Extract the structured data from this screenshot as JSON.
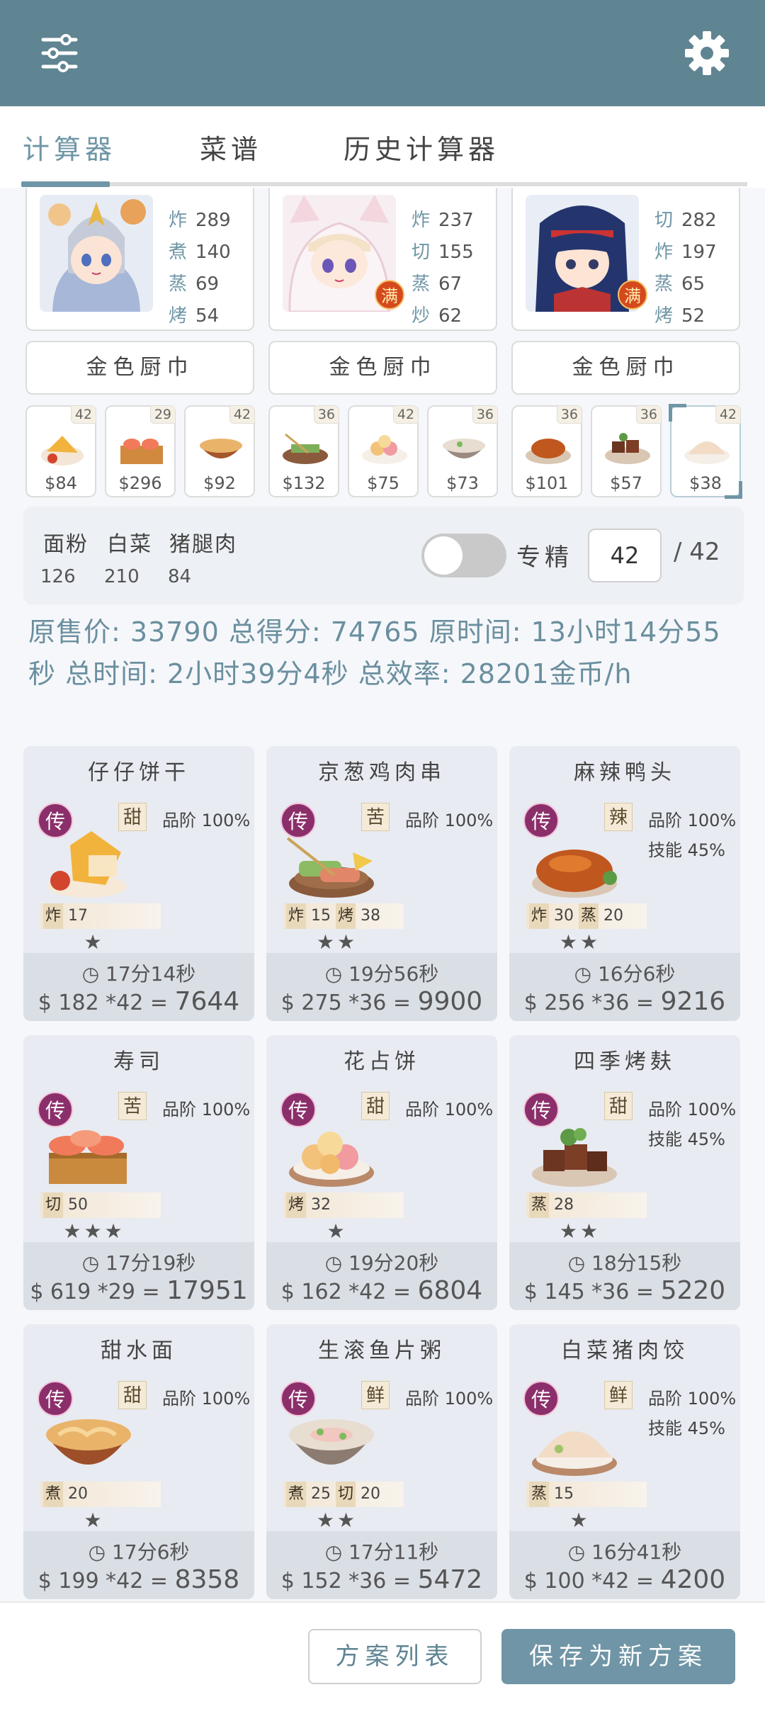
{
  "colors": {
    "header": "#5f8492",
    "accent": "#6f96a6",
    "legend_badge": "#8b2f6b",
    "full_badge": "#d44a1c"
  },
  "header": {
    "menu_icon": "sliders-icon",
    "settings_icon": "gear-icon"
  },
  "tabs": [
    {
      "label": "计算器",
      "active": true
    },
    {
      "label": "菜谱",
      "active": false
    },
    {
      "label": "历史计算器",
      "active": false
    }
  ],
  "chefs": [
    {
      "stats": [
        {
          "k": "炸",
          "v": "289"
        },
        {
          "k": "煮",
          "v": "140"
        },
        {
          "k": "蒸",
          "v": "69"
        },
        {
          "k": "烤",
          "v": "54"
        }
      ],
      "full": ""
    },
    {
      "stats": [
        {
          "k": "炸",
          "v": "237"
        },
        {
          "k": "切",
          "v": "155"
        },
        {
          "k": "蒸",
          "v": "67"
        },
        {
          "k": "炒",
          "v": "62"
        }
      ],
      "full": "满"
    },
    {
      "stats": [
        {
          "k": "切",
          "v": "282"
        },
        {
          "k": "炸",
          "v": "197"
        },
        {
          "k": "蒸",
          "v": "65"
        },
        {
          "k": "烤",
          "v": "52"
        }
      ],
      "full": "满"
    }
  ],
  "tools": [
    "金色厨巾",
    "金色厨巾",
    "金色厨巾"
  ],
  "dishes": [
    {
      "count": "42",
      "price": "$84"
    },
    {
      "count": "29",
      "price": "$296"
    },
    {
      "count": "42",
      "price": "$92"
    },
    {
      "count": "36",
      "price": "$132"
    },
    {
      "count": "42",
      "price": "$75"
    },
    {
      "count": "36",
      "price": "$73"
    },
    {
      "count": "36",
      "price": "$101"
    },
    {
      "count": "36",
      "price": "$57"
    },
    {
      "count": "42",
      "price": "$38"
    }
  ],
  "materials": [
    {
      "name": "面粉",
      "value": "126"
    },
    {
      "name": "白菜",
      "value": "210"
    },
    {
      "name": "猪腿肉",
      "value": "84"
    }
  ],
  "specialty": {
    "label": "专精",
    "enabled": false,
    "value": "42",
    "max": "/ 42"
  },
  "summary": "原售价: 33790 总得分: 74765 原时间: 13小时14分55秒 总时间: 2小时39分4秒 总效率: 28201金币/h",
  "recipes": [
    {
      "name": "仔仔饼干",
      "badge": "传",
      "flavor": "甜",
      "grade": [
        "品阶 100%"
      ],
      "skills": [
        {
          "k": "炸",
          "v": "17"
        }
      ],
      "stars": "★",
      "time": "17分14秒",
      "price": "$ 182 *42 =",
      "total": "7644"
    },
    {
      "name": "京葱鸡肉串",
      "badge": "传",
      "flavor": "苦",
      "grade": [
        "品阶 100%"
      ],
      "skills": [
        {
          "k": "炸",
          "v": "15"
        },
        {
          "k": "烤",
          "v": "38"
        }
      ],
      "stars": "★★",
      "time": "19分56秒",
      "price": "$ 275 *36 =",
      "total": "9900"
    },
    {
      "name": "麻辣鸭头",
      "badge": "传",
      "flavor": "辣",
      "grade": [
        "品阶 100%",
        "技能 45%"
      ],
      "skills": [
        {
          "k": "炸",
          "v": "30"
        },
        {
          "k": "蒸",
          "v": "20"
        }
      ],
      "stars": "★★",
      "time": "16分6秒",
      "price": "$ 256 *36 =",
      "total": "9216"
    },
    {
      "name": "寿司",
      "badge": "传",
      "flavor": "苦",
      "grade": [
        "品阶 100%"
      ],
      "skills": [
        {
          "k": "切",
          "v": "50"
        }
      ],
      "stars": "★★★",
      "time": "17分19秒",
      "price": "$ 619 *29 =",
      "total": "17951"
    },
    {
      "name": "花占饼",
      "badge": "传",
      "flavor": "甜",
      "grade": [
        "品阶 100%"
      ],
      "skills": [
        {
          "k": "烤",
          "v": "32"
        }
      ],
      "stars": "★",
      "time": "19分20秒",
      "price": "$ 162 *42 =",
      "total": "6804"
    },
    {
      "name": "四季烤麸",
      "badge": "传",
      "flavor": "甜",
      "grade": [
        "品阶 100%",
        "技能 45%"
      ],
      "skills": [
        {
          "k": "蒸",
          "v": "28"
        }
      ],
      "stars": "★★",
      "time": "18分15秒",
      "price": "$ 145 *36 =",
      "total": "5220"
    },
    {
      "name": "甜水面",
      "badge": "传",
      "flavor": "甜",
      "grade": [
        "品阶 100%"
      ],
      "skills": [
        {
          "k": "煮",
          "v": "20"
        }
      ],
      "stars": "★",
      "time": "17分6秒",
      "price": "$ 199 *42 =",
      "total": "8358"
    },
    {
      "name": "生滚鱼片粥",
      "badge": "传",
      "flavor": "鲜",
      "grade": [
        "品阶 100%"
      ],
      "skills": [
        {
          "k": "煮",
          "v": "25"
        },
        {
          "k": "切",
          "v": "20"
        }
      ],
      "stars": "★★",
      "time": "17分11秒",
      "price": "$ 152 *36 =",
      "total": "5472"
    },
    {
      "name": "白菜猪肉饺",
      "badge": "传",
      "flavor": "鲜",
      "grade": [
        "品阶 100%",
        "技能 45%"
      ],
      "skills": [
        {
          "k": "蒸",
          "v": "15"
        }
      ],
      "stars": "★",
      "time": "16分41秒",
      "price": "$ 100 *42 =",
      "total": "4200"
    }
  ],
  "footer": {
    "list_button": "方案列表",
    "save_button": "保存为新方案"
  }
}
